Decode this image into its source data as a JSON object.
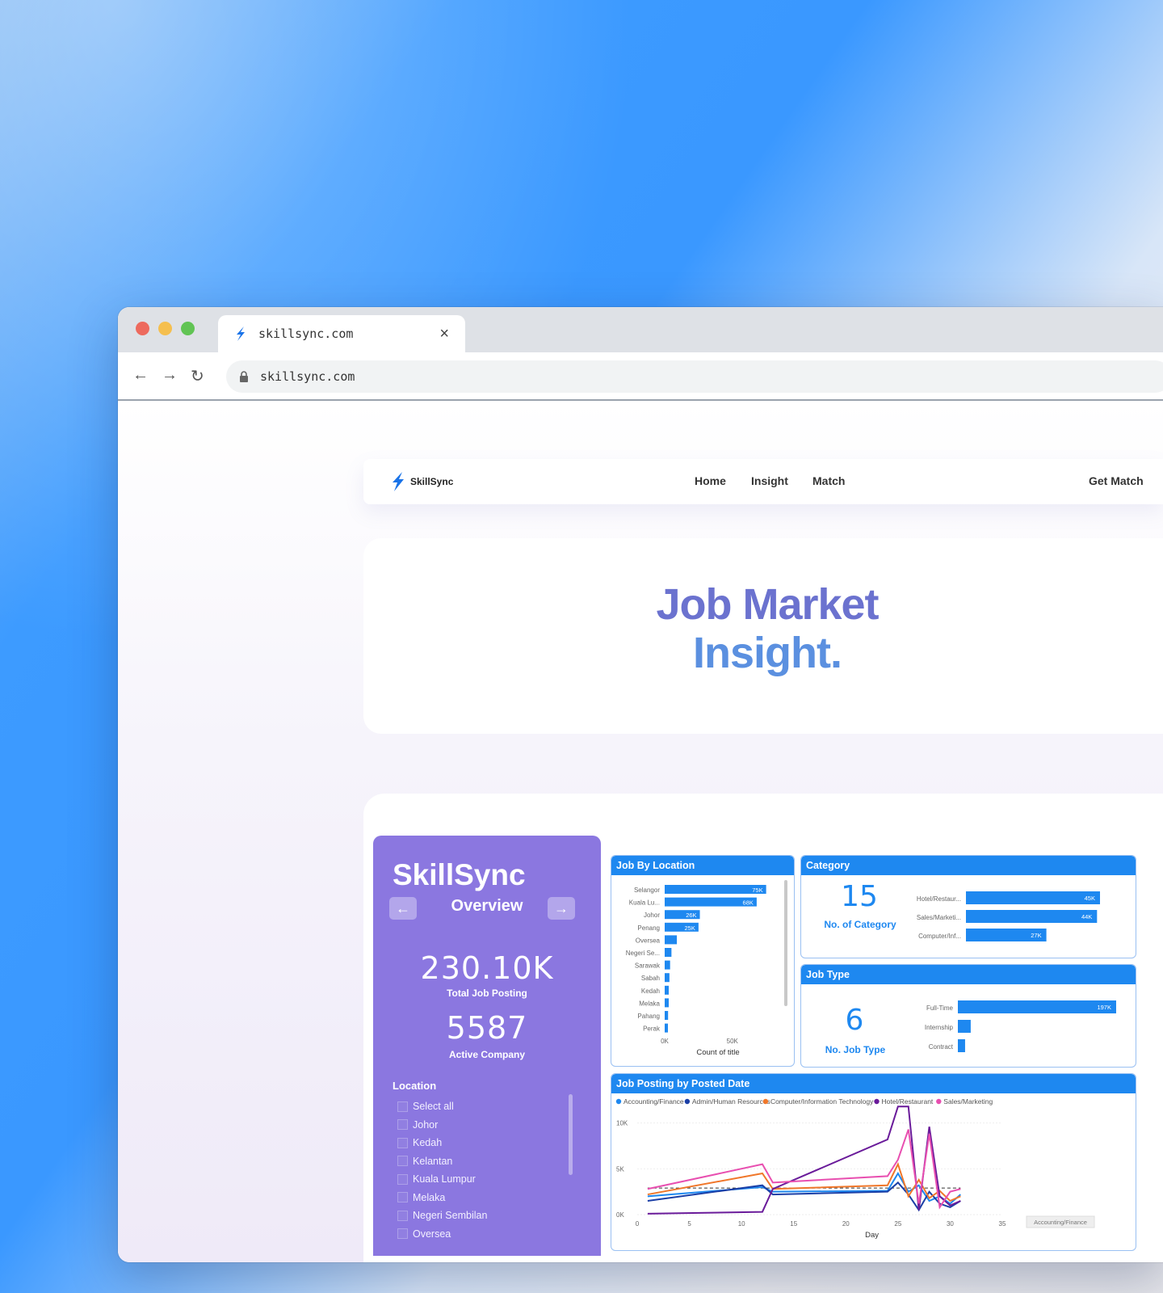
{
  "browser": {
    "tab_title": "skillsync.com",
    "url": "skillsync.com"
  },
  "navbar": {
    "brand": "SkillSync",
    "links": [
      "Home",
      "Insight",
      "Match"
    ],
    "cta": "Get Match"
  },
  "hero": {
    "line1": "Job Market",
    "line2": "Insight."
  },
  "sidebar": {
    "brand": "SkillSync",
    "view_title": "Overview",
    "kpis": [
      {
        "value": "230.10K",
        "label": "Total Job Posting"
      },
      {
        "value": "5587",
        "label": "Active Company"
      }
    ],
    "location_title": "Location",
    "locations": [
      "Select all",
      "Johor",
      "Kedah",
      "Kelantan",
      "Kuala Lumpur",
      "Melaka",
      "Negeri Sembilan",
      "Oversea"
    ]
  },
  "colors": {
    "accent": "#1e88f0",
    "sidebar": "#8b77e0",
    "hero1": "#6b72cf",
    "hero2": "#5b90e0"
  },
  "chart_data": [
    {
      "type": "bar",
      "title": "Job By Location",
      "orientation": "horizontal",
      "categories": [
        "Selangor",
        "Kuala Lu...",
        "Johor",
        "Penang",
        "Oversea",
        "Negeri Se...",
        "Sarawak",
        "Sabah",
        "Kedah",
        "Melaka",
        "Pahang",
        "Perak"
      ],
      "values": [
        75000,
        68000,
        26000,
        25000,
        9000,
        5000,
        4000,
        3500,
        3000,
        3000,
        2500,
        2000
      ],
      "data_labels": [
        "75K",
        "68K",
        "26K",
        "25K",
        "",
        "",
        "",
        "",
        "",
        "",
        "",
        ""
      ],
      "xlabel": "Count of title",
      "xticks": [
        "0K",
        "50K"
      ],
      "xlim": [
        0,
        80000
      ]
    },
    {
      "type": "bar",
      "title": "Category",
      "orientation": "horizontal",
      "kpi_value": "15",
      "kpi_label": "No. of Category",
      "categories": [
        "Hotel/Restaur...",
        "Sales/Marketi...",
        "Computer/Inf..."
      ],
      "values": [
        45000,
        44000,
        27000
      ],
      "data_labels": [
        "45K",
        "44K",
        "27K"
      ],
      "xlim": [
        0,
        45000
      ]
    },
    {
      "type": "bar",
      "title": "Job Type",
      "orientation": "horizontal",
      "kpi_value": "6",
      "kpi_label": "No. Job Type",
      "categories": [
        "Full-Time",
        "Internship",
        "Contract"
      ],
      "values": [
        197000,
        16000,
        9000
      ],
      "data_labels": [
        "197K",
        "",
        ""
      ],
      "xlim": [
        0,
        197000
      ]
    },
    {
      "type": "line",
      "title": "Job Posting by Posted Date",
      "xlabel": "Day",
      "xlim": [
        0,
        35
      ],
      "ylim": [
        0,
        12000
      ],
      "xticks": [
        0,
        5,
        10,
        15,
        20,
        25,
        30,
        35
      ],
      "yticks": [
        "0K",
        "5K",
        "10K"
      ],
      "average_line": 2900,
      "tooltip": "Accounting/Finance",
      "x": [
        1,
        12,
        13,
        24,
        25,
        26,
        27,
        28,
        29,
        30,
        31
      ],
      "series": [
        {
          "name": "Accounting/Finance",
          "color": "#1e88f0",
          "values": [
            2000,
            3000,
            2500,
            2600,
            4500,
            2500,
            3200,
            1500,
            2000,
            1200,
            2200
          ]
        },
        {
          "name": "Admin/Human Resources",
          "color": "#1b3fa6",
          "values": [
            1500,
            3200,
            2200,
            2500,
            3500,
            2200,
            500,
            2500,
            1200,
            800,
            1500
          ]
        },
        {
          "name": "Computer/Information Technology",
          "color": "#f0772a",
          "values": [
            2200,
            4500,
            2800,
            3200,
            5500,
            2000,
            3800,
            1800,
            2600,
            1500,
            2000
          ]
        },
        {
          "name": "Hotel/Restaurant",
          "color": "#6a1b9a",
          "values": [
            100,
            300,
            2800,
            8200,
            11800,
            11800,
            500,
            9600,
            2000,
            1000,
            1500
          ]
        },
        {
          "name": "Sales/Marketing",
          "color": "#e84fb0",
          "values": [
            2800,
            5500,
            3500,
            4200,
            6000,
            9300,
            1200,
            8800,
            800,
            2500,
            2800
          ]
        }
      ]
    }
  ]
}
